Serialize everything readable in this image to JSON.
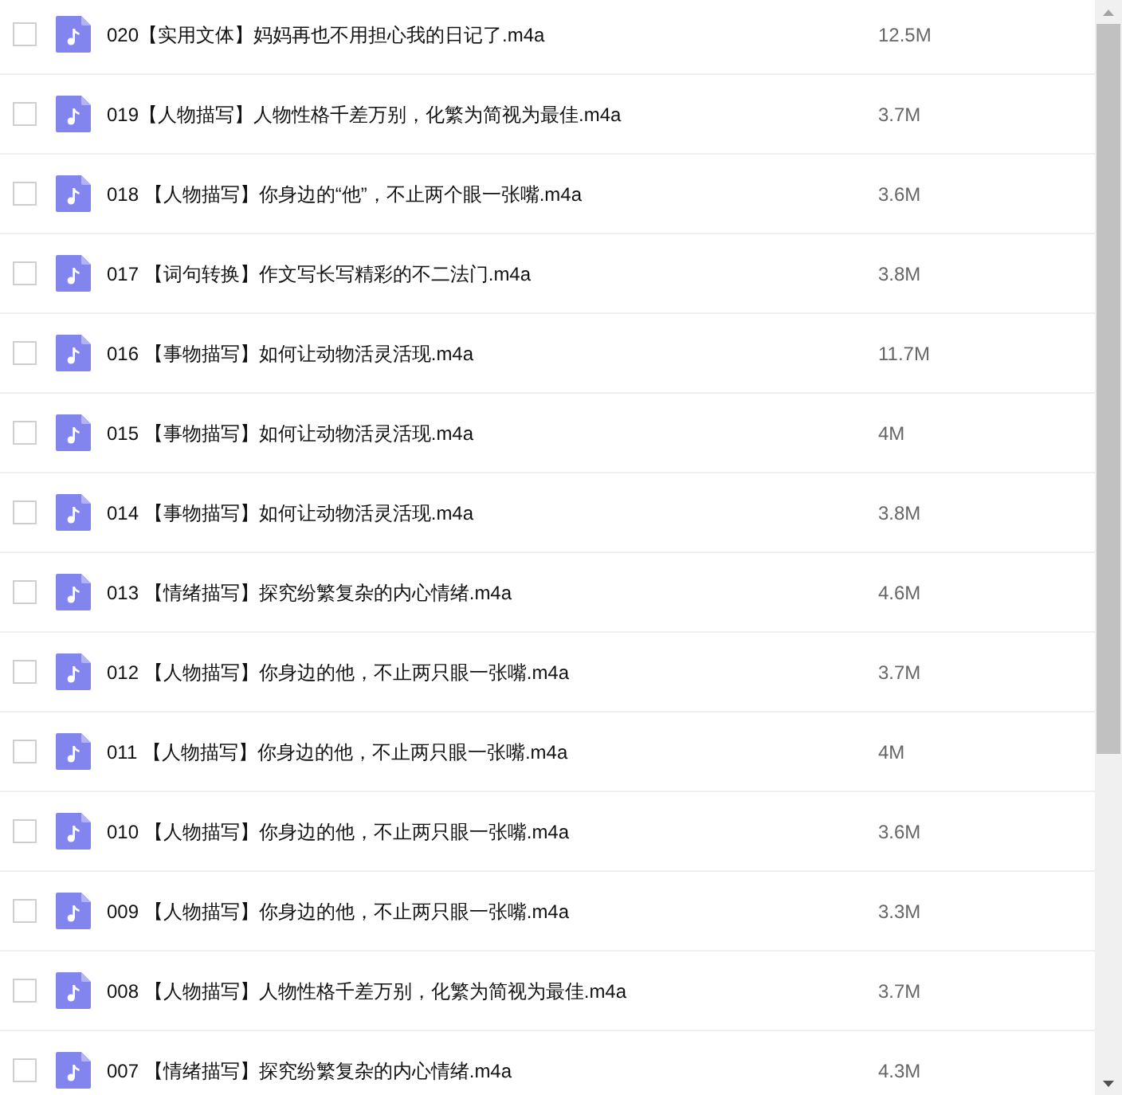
{
  "files": [
    {
      "name": "020【实用文体】妈妈再也不用担心我的日记了.m4a",
      "size": "12.5M",
      "checked": false
    },
    {
      "name": "019【人物描写】人物性格千差万别，化繁为简视为最佳.m4a",
      "size": "3.7M",
      "checked": false
    },
    {
      "name": "018 【人物描写】你身边的“他”，不止两个眼一张嘴.m4a",
      "size": "3.6M",
      "checked": false
    },
    {
      "name": "017 【词句转换】作文写长写精彩的不二法门.m4a",
      "size": "3.8M",
      "checked": false
    },
    {
      "name": "016 【事物描写】如何让动物活灵活现.m4a",
      "size": "11.7M",
      "checked": false
    },
    {
      "name": "015 【事物描写】如何让动物活灵活现.m4a",
      "size": "4M",
      "checked": false
    },
    {
      "name": "014 【事物描写】如何让动物活灵活现.m4a",
      "size": "3.8M",
      "checked": false
    },
    {
      "name": "013 【情绪描写】探究纷繁复杂的内心情绪.m4a",
      "size": "4.6M",
      "checked": false
    },
    {
      "name": "012 【人物描写】你身边的他，不止两只眼一张嘴.m4a",
      "size": "3.7M",
      "checked": false
    },
    {
      "name": "011 【人物描写】你身边的他，不止两只眼一张嘴.m4a",
      "size": "4M",
      "checked": false
    },
    {
      "name": "010 【人物描写】你身边的他，不止两只眼一张嘴.m4a",
      "size": "3.6M",
      "checked": false
    },
    {
      "name": "009 【人物描写】你身边的他，不止两只眼一张嘴.m4a",
      "size": "3.3M",
      "checked": false
    },
    {
      "name": "008 【人物描写】人物性格千差万别，化繁为简视为最佳.m4a",
      "size": "3.7M",
      "checked": false
    },
    {
      "name": "007 【情绪描写】探究纷繁复杂的内心情绪.m4a",
      "size": "4.3M",
      "checked": false
    }
  ]
}
